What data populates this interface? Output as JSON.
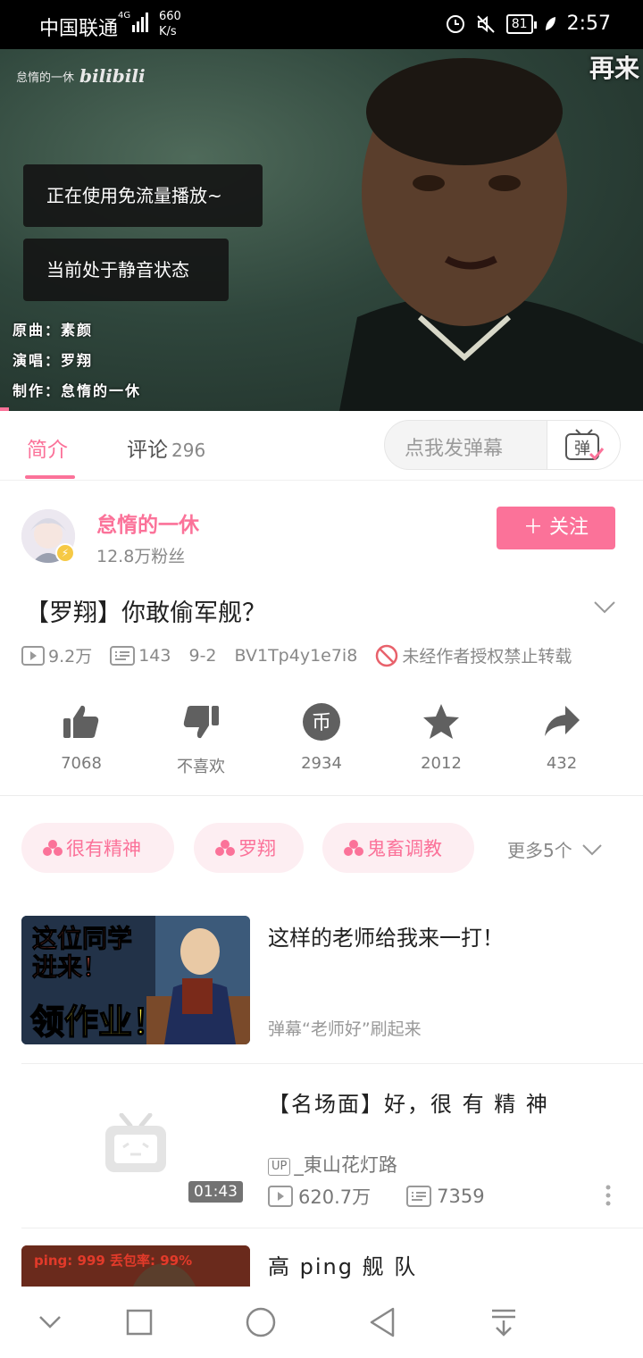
{
  "status_bar": {
    "carrier": "中国联通",
    "network": "4G",
    "speed_value": "660",
    "speed_unit": "K/s",
    "battery": "81",
    "time": "2:57"
  },
  "video": {
    "watermark_text": "怠惰的一休",
    "watermark_logo": "bilibili",
    "corner_text": "再来",
    "toasts": [
      "正在使用免流量播放~",
      "当前处于静音状态"
    ],
    "credits": [
      "原曲：素颜",
      "演唱：罗翔",
      "制作：怠惰的一休"
    ],
    "progress": 0.014
  },
  "tabs": {
    "intro": "简介",
    "comments": "评论",
    "comment_count": "296",
    "danmaku_placeholder": "点我发弹幕",
    "danmaku_icon_char": "弹"
  },
  "uploader": {
    "name": "怠惰的一休",
    "fans": "12.8万粉丝",
    "follow_label": "＋ 关注"
  },
  "video_info": {
    "title": "【罗翔】你敢偷军舰？",
    "views": "9.2万",
    "danmaku_count": "143",
    "date": "9-2",
    "bvid": "BV1Tp4y1e7i8",
    "no_repost": "未经作者授权禁止转载"
  },
  "actions": [
    {
      "icon": "thumbs-up-icon",
      "label": "7068"
    },
    {
      "icon": "thumbs-down-icon",
      "label": "不喜欢"
    },
    {
      "icon": "coin-icon",
      "label": "2934",
      "coin_char": "币"
    },
    {
      "icon": "star-icon",
      "label": "2012"
    },
    {
      "icon": "share-icon",
      "label": "432"
    }
  ],
  "tags": [
    "很有精神",
    "罗翔",
    "鬼畜调教"
  ],
  "tags_more": "更多5个",
  "recommendations": [
    {
      "title": "这样的老师给我来一打！",
      "subtitle": "弹幕“老师好”刷起来",
      "thumb_caption": [
        "这位同学",
        "进来！",
        "领作业！"
      ]
    },
    {
      "title": "【名场面】好，很 有 精 神",
      "up_tag": "UP",
      "uploader": "_東山花灯路",
      "views": "620.7万",
      "danmaku": "7359",
      "duration": "01:43"
    },
    {
      "title": "高 ping 舰 队",
      "thumb_caption": "ping: 999   丢包率: 99%"
    }
  ],
  "colors": {
    "accent": "#fb7299",
    "tag_bg": "#fdeef2",
    "text_primary": "#212121",
    "text_secondary": "#888888"
  }
}
